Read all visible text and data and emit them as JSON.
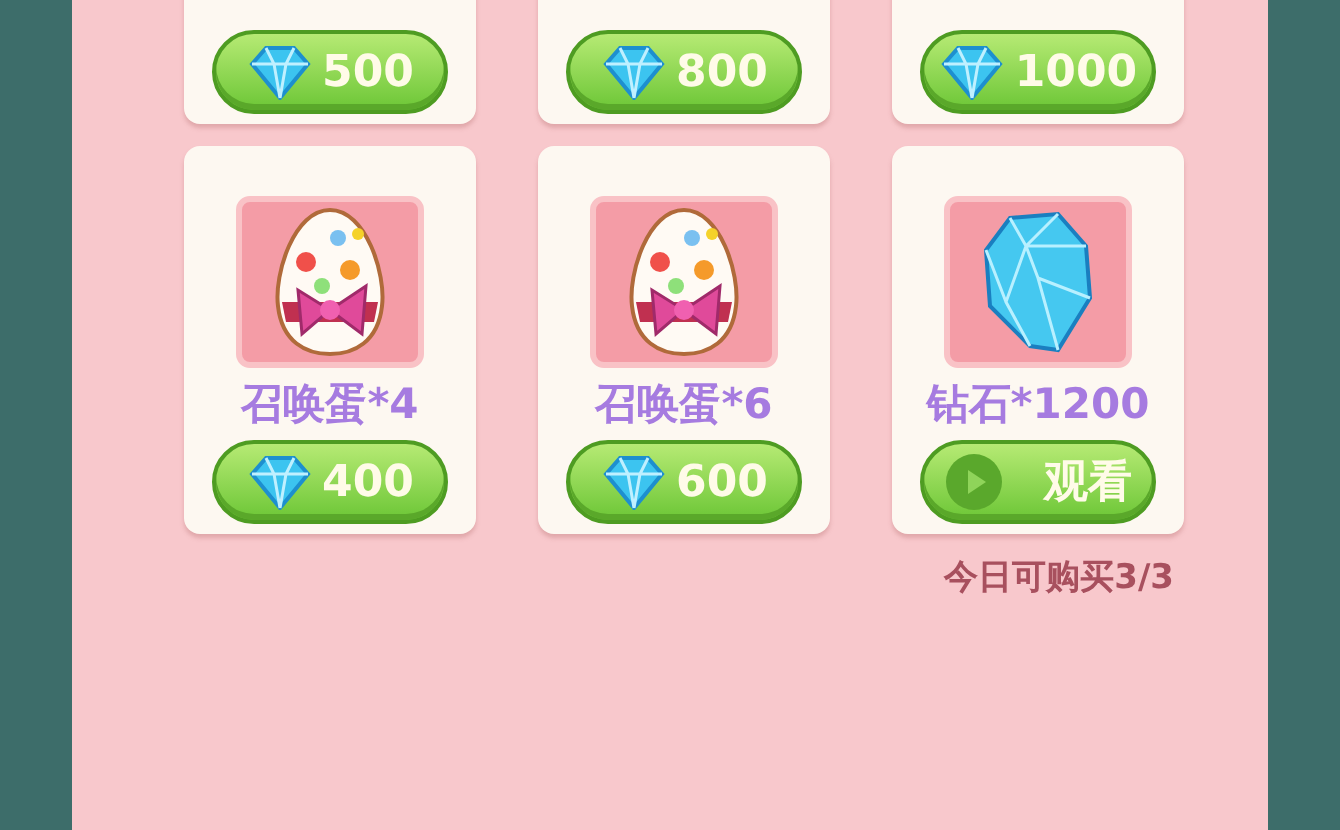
{
  "items": [
    {
      "kind": "plain",
      "button": {
        "kind": "price",
        "label": "500"
      }
    },
    {
      "kind": "plain",
      "button": {
        "kind": "price",
        "label": "800"
      }
    },
    {
      "kind": "plain",
      "button": {
        "kind": "price",
        "label": "1000"
      }
    },
    {
      "kind": "egg",
      "name": "召唤蛋*4",
      "button": {
        "kind": "price",
        "label": "400"
      }
    },
    {
      "kind": "egg",
      "name": "召唤蛋*6",
      "button": {
        "kind": "price",
        "label": "600"
      }
    },
    {
      "kind": "crystal",
      "name": "钻石*1200",
      "button": {
        "kind": "watch",
        "label": "观看"
      }
    }
  ],
  "daily_limit": "今日可购买3/3"
}
